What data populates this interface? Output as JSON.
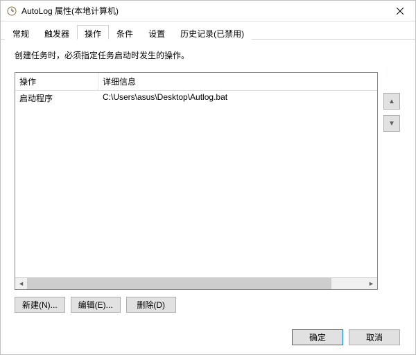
{
  "window": {
    "title": "AutoLog 属性(本地计算机)"
  },
  "tabs": [
    {
      "label": "常规"
    },
    {
      "label": "触发器"
    },
    {
      "label": "操作",
      "active": true
    },
    {
      "label": "条件"
    },
    {
      "label": "设置"
    },
    {
      "label": "历史记录(已禁用)"
    }
  ],
  "intro": "创建任务时，必须指定任务启动时发生的操作。",
  "table": {
    "headers": [
      "操作",
      "详细信息"
    ],
    "rows": [
      {
        "action": "启动程序",
        "details": "C:\\Users\\asus\\Desktop\\Autlog.bat"
      }
    ]
  },
  "buttons": {
    "new": "新建(N)...",
    "edit": "编辑(E)...",
    "delete": "删除(D)",
    "ok": "确定",
    "cancel": "取消"
  },
  "arrows": {
    "up": "▲",
    "down": "▼",
    "left": "◄",
    "right": "►"
  }
}
